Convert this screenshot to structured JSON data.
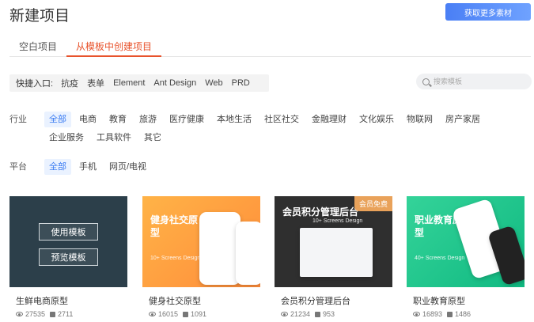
{
  "header": {
    "title": "新建项目",
    "promo_label": "获取更多素材"
  },
  "tabs": [
    {
      "label": "空白项目",
      "active": false
    },
    {
      "label": "从模板中创建项目",
      "active": true
    }
  ],
  "quick": {
    "label": "快捷入口:",
    "items": [
      "抗疫",
      "表单",
      "Element",
      "Ant Design",
      "Web",
      "PRD"
    ]
  },
  "search": {
    "placeholder": "搜索模板"
  },
  "filters": {
    "industry": {
      "label": "行业",
      "options": [
        "全部",
        "电商",
        "教育",
        "旅游",
        "医疗健康",
        "本地生活",
        "社区社交",
        "金融理财",
        "文化娱乐",
        "物联网",
        "房产家居",
        "企业服务",
        "工具软件",
        "其它"
      ]
    },
    "platform": {
      "label": "平台",
      "options": [
        "全部",
        "手机",
        "网页/电视"
      ]
    }
  },
  "cards": [
    {
      "title": "生鲜电商原型",
      "views": "27535",
      "downloads": "2711",
      "use_label": "使用模板",
      "preview_label": "预览模板"
    },
    {
      "title": "健身社交原型",
      "views": "16015",
      "downloads": "1091",
      "thumb_text": "健身社交原型",
      "thumb_sub": "10+ Screens Design"
    },
    {
      "title": "会员积分管理后台",
      "views": "21234",
      "downloads": "953",
      "thumb_text": "会员积分管理后台",
      "thumb_sub": "10+ Screens Design",
      "badge": "会员免费"
    },
    {
      "title": "职业教育原型",
      "views": "16893",
      "downloads": "1486",
      "thumb_text": "职业教育原型",
      "thumb_sub": "40+ Screens Design"
    }
  ],
  "colors": {
    "accent": "#e8532c",
    "primary": "#3a7bf2"
  }
}
